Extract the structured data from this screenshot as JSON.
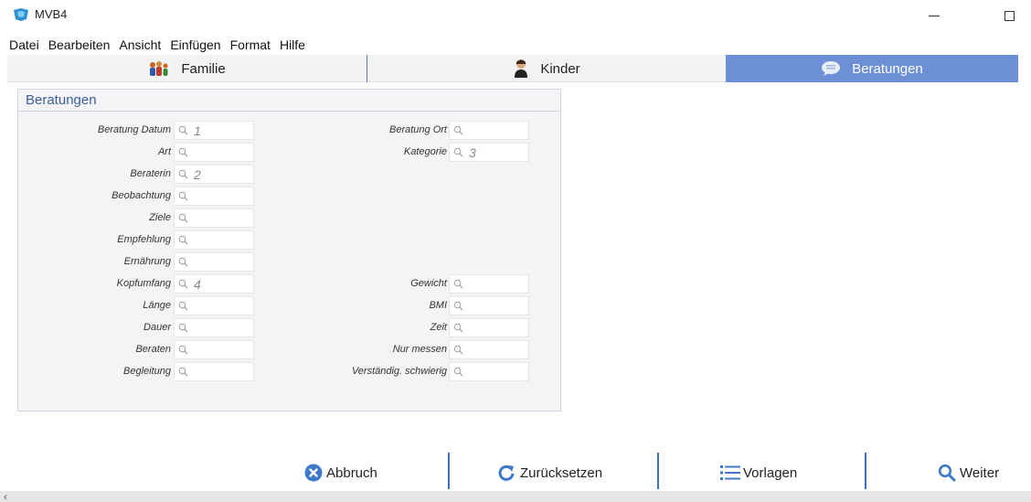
{
  "window": {
    "title": "MVB4"
  },
  "menu": [
    "Datei",
    "Bearbeiten",
    "Ansicht",
    "Einfügen",
    "Format",
    "Hilfe"
  ],
  "tabs": [
    {
      "label": "Familie",
      "active": false,
      "icon": "family-icon"
    },
    {
      "label": "Kinder",
      "active": false,
      "icon": "child-icon"
    },
    {
      "label": "Beratungen",
      "active": true,
      "icon": "speech-bubble-icon"
    }
  ],
  "panel": {
    "title": "Beratungen",
    "left_fields": [
      {
        "label": "Beratung Datum",
        "value": "1"
      },
      {
        "label": "Art",
        "value": ""
      },
      {
        "label": "Beraterin",
        "value": "2"
      },
      {
        "label": "Beobachtung",
        "value": ""
      },
      {
        "label": "Ziele",
        "value": ""
      },
      {
        "label": "Empfehlung",
        "value": ""
      },
      {
        "label": "Ernährung",
        "value": ""
      },
      {
        "label": "Kopfumfang",
        "value": "4"
      },
      {
        "label": "Länge",
        "value": ""
      },
      {
        "label": "Dauer",
        "value": ""
      },
      {
        "label": "Beraten",
        "value": ""
      },
      {
        "label": "Begleitung",
        "value": ""
      }
    ],
    "right_fields": [
      {
        "label": "Beratung Ort",
        "value": ""
      },
      {
        "label": "Kategorie",
        "value": "3"
      },
      {
        "label": "Gewicht",
        "value": ""
      },
      {
        "label": "BMI",
        "value": ""
      },
      {
        "label": "Zeit",
        "value": ""
      },
      {
        "label": "Nur messen",
        "value": ""
      },
      {
        "label": "Verständig. schwierig",
        "value": ""
      }
    ]
  },
  "toolbar": {
    "abbruch": "Abbruch",
    "zuruecksetzen": "Zurücksetzen",
    "vorlagen": "Vorlagen",
    "weiter": "Weiter"
  },
  "colors": {
    "accent": "#6d8fd6",
    "separator": "#3b73c7",
    "panel_title": "#3c5f9c"
  }
}
